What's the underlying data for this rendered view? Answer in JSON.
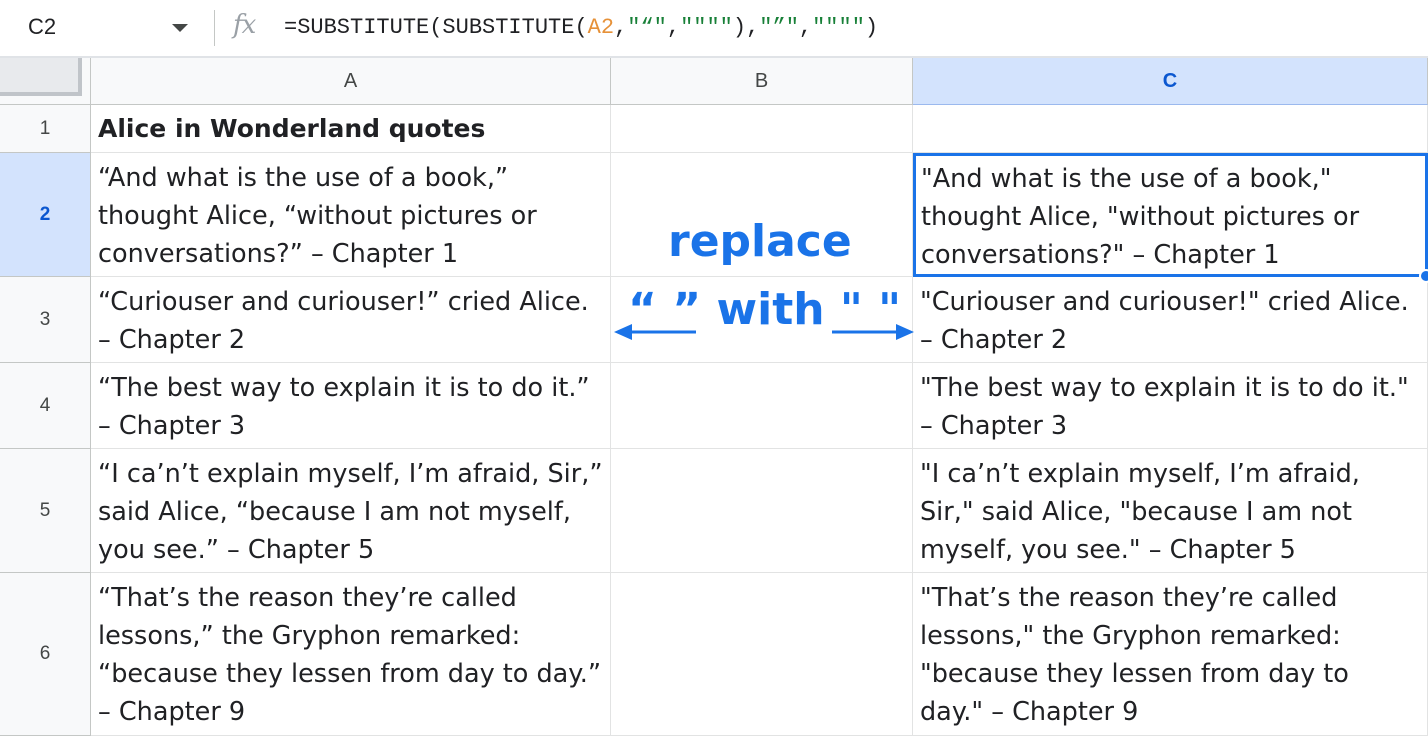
{
  "formula_bar": {
    "name_box": "C2",
    "fx_label": "fx",
    "formula_prefix": "=SUBSTITUTE(SUBSTITUTE(",
    "formula_ref": "A2",
    "formula_sep1": ",",
    "formula_str1": "\"“\"",
    "formula_sep2": ",",
    "formula_str2": "\"\"\"\"",
    "formula_mid": "),",
    "formula_str3": "\"”\"",
    "formula_sep3": ",",
    "formula_str4": "\"\"\"\"",
    "formula_suffix": ")"
  },
  "columns": [
    "A",
    "B",
    "C"
  ],
  "rows": [
    "1",
    "2",
    "3",
    "4",
    "5",
    "6"
  ],
  "cells": {
    "A1": "Alice in Wonderland quotes",
    "A2": "“And what is the use of a book,” thought Alice, “without pictures or conversations?” – Chapter 1",
    "A3": "“Curiouser and curiouser!” cried Alice. – Chapter 2",
    "A4": "“The best way to explain it is to do it.” – Chapter 3",
    "A5": "“I ca’n’t explain myself, I’m afraid, Sir,” said Alice, “because I am not myself, you see.” – Chapter 5",
    "A6": "“That’s the reason they’re called lessons,” the Gryphon remarked: “because they lessen from day to day.” – Chapter 9",
    "C2": "\"And what is the use of a book,\" thought Alice, \"without pictures or conversations?\" – Chapter 1",
    "C3": "\"Curiouser and curiouser!\" cried Alice. – Chapter 2",
    "C4": "\"The best way to explain it is to do it.\" – Chapter 3",
    "C5": "\"I ca’n’t explain myself, I’m afraid, Sir,\" said Alice, \"because I am not myself, you see.\" – Chapter 5",
    "C6": "\"That’s the reason they’re called lessons,\" the Gryphon remarked: \"because they lessen from day to day.\" – Chapter 9"
  },
  "annotation": {
    "line1": "replace",
    "line2": "“ ” with \" \""
  },
  "colors": {
    "accent": "#1a73e8",
    "formula_ref": "#e69138",
    "formula_string": "#188038",
    "active_header": "#d3e3fd"
  },
  "icons": [
    "dropdown-caret-icon",
    "fx-icon",
    "left-arrow-icon",
    "right-arrow-icon"
  ]
}
